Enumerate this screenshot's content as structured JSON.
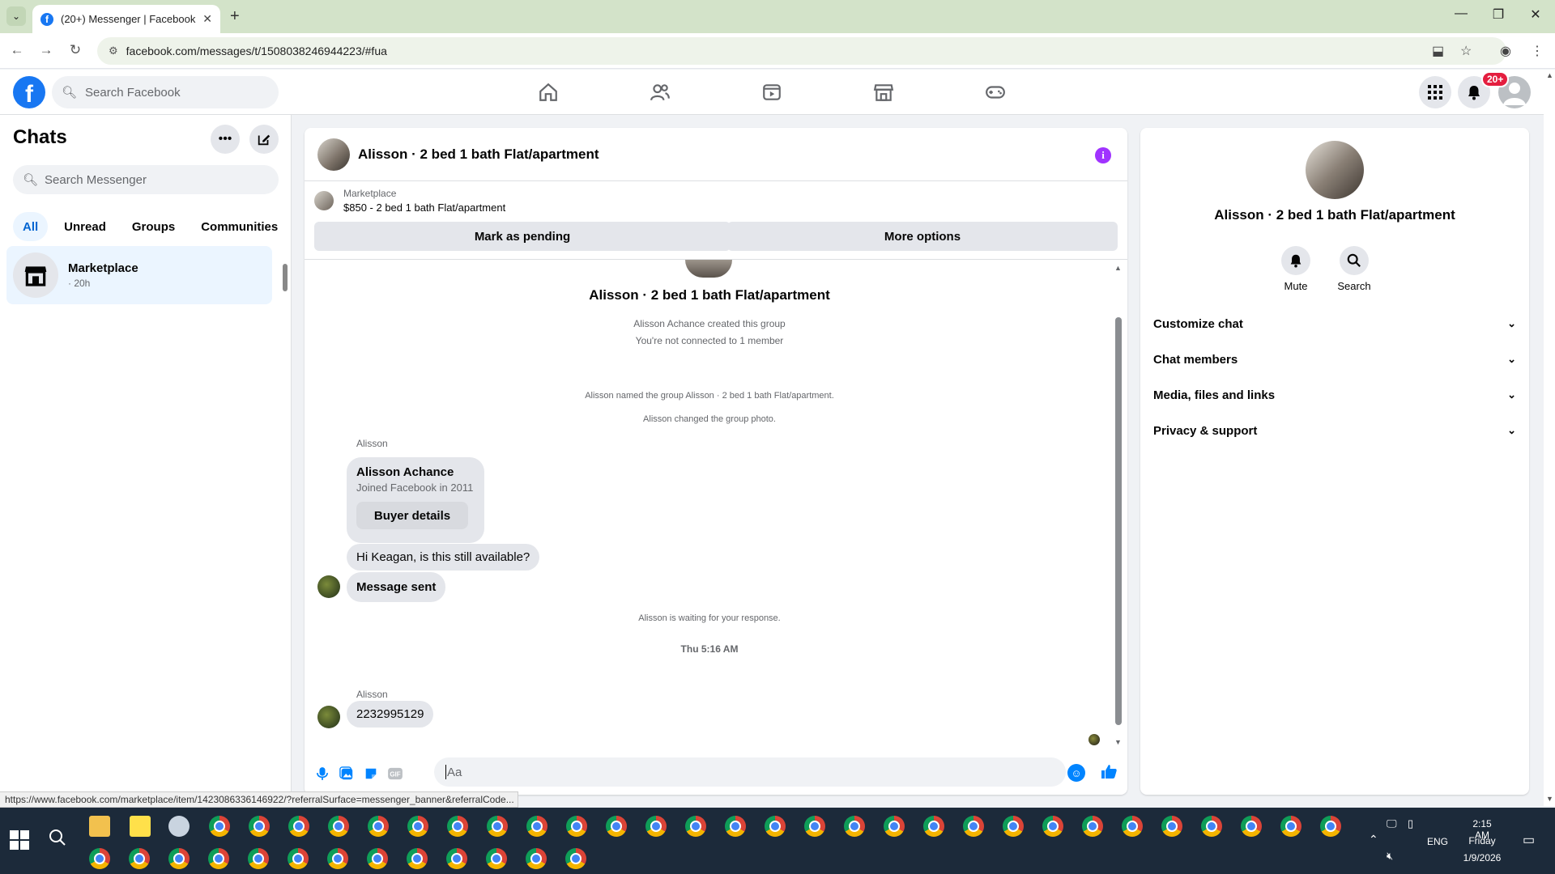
{
  "browser": {
    "tab_title": "(20+) Messenger | Facebook",
    "url": "facebook.com/messages/t/1508038246944223/#fua",
    "status_url": "https://www.facebook.com/marketplace/item/1423086336146922/?referralSurface=messenger_banner&referralCode..."
  },
  "fb": {
    "search_placeholder": "Search Facebook",
    "notification_badge": "20+"
  },
  "chats": {
    "title": "Chats",
    "search_placeholder": "Search Messenger",
    "filters": [
      "All",
      "Unread",
      "Groups",
      "Communities"
    ],
    "active_filter": "All",
    "items": [
      {
        "name": "Marketplace",
        "time": "· 20h"
      }
    ]
  },
  "conversation": {
    "title": "Alisson · 2 bed 1 bath Flat/apartment",
    "marketplace_label": "Marketplace",
    "listing": "$850 - 2 bed 1 bath Flat/apartment",
    "mark_pending_label": "Mark as pending",
    "more_options_label": "More options",
    "group_name": "Alisson · 2 bed 1 bath Flat/apartment",
    "created_text": "Alisson Achance created this group",
    "connected_text": "You're not connected to 1 member",
    "named_text": "Alisson named the group Alisson · 2 bed 1 bath Flat/apartment.",
    "photo_text": "Alisson changed the group photo.",
    "sender1": "Alisson",
    "card_name": "Alisson Achance",
    "card_sub": "Joined Facebook in 2011",
    "card_button": "Buyer details",
    "message1": "Hi Keagan, is this still available?",
    "message2": "Message sent",
    "waiting_text": "Alisson is waiting for your response.",
    "timestamp": "Thu 5:16 AM",
    "sender2": "Alisson",
    "message3": "2232995129",
    "input_placeholder": "Aa"
  },
  "info_panel": {
    "name": "Alisson · 2 bed 1 bath Flat/apartment",
    "mute_label": "Mute",
    "search_label": "Search",
    "sections": [
      "Customize chat",
      "Chat members",
      "Media, files and links",
      "Privacy & support"
    ]
  },
  "taskbar": {
    "time": "2:15 AM",
    "day": "Friday",
    "date": "1/9/2026",
    "lang": "ENG"
  },
  "colors": {
    "fb_blue": "#1877f2",
    "messenger_blue": "#0084ff",
    "active_chat_bg": "#ebf5ff",
    "info_purple": "#a033ff",
    "badge_red": "#e41e3f"
  }
}
